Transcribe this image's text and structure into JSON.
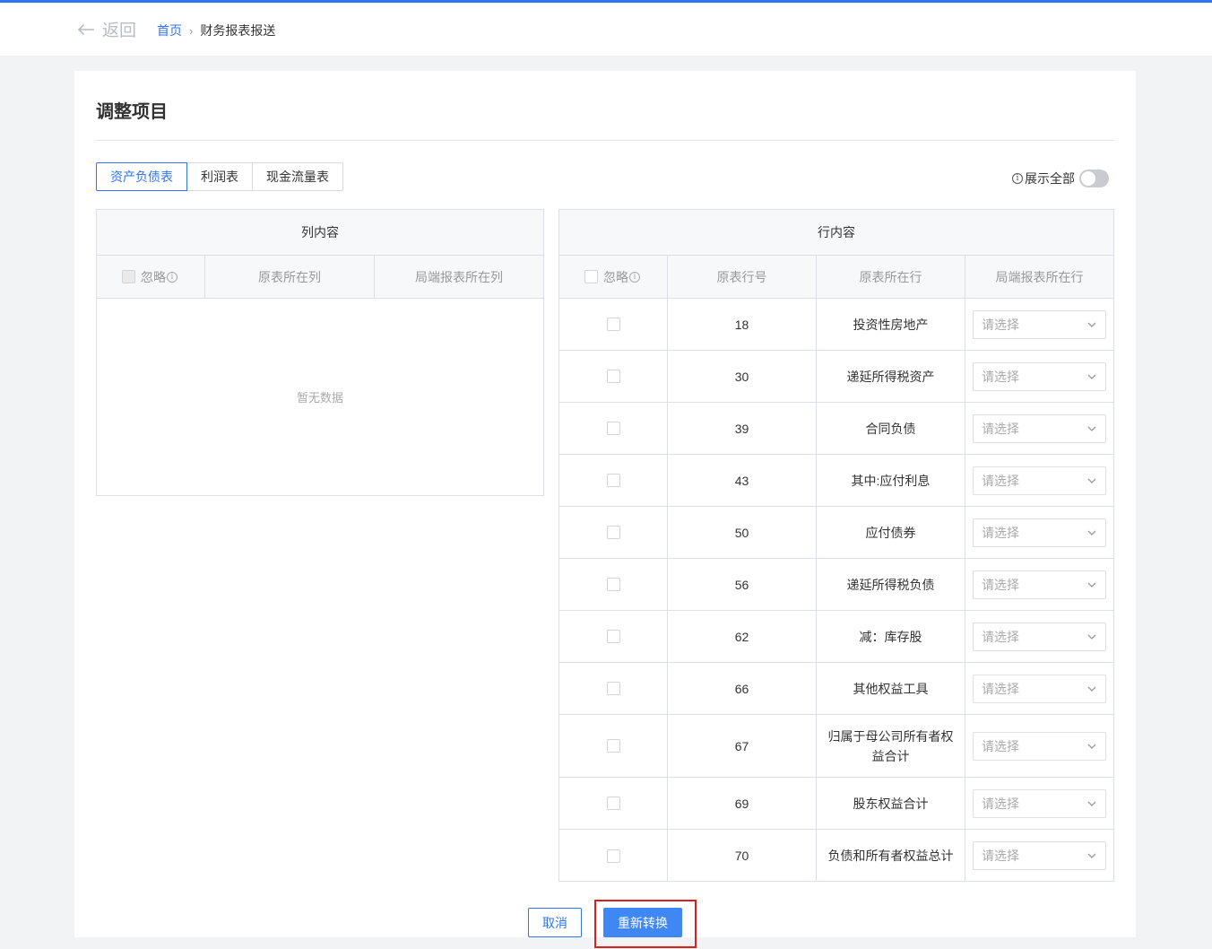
{
  "nav": {
    "back_label": "返回",
    "breadcrumb": {
      "home": "首页",
      "separator": "›",
      "current": "财务报表报送"
    }
  },
  "page": {
    "title": "调整项目"
  },
  "tabs": [
    {
      "label": "资产负债表",
      "active": true
    },
    {
      "label": "利润表",
      "active": false
    },
    {
      "label": "现金流量表",
      "active": false
    }
  ],
  "show_all": {
    "label": "展示全部",
    "enabled": false,
    "info_icon": "i"
  },
  "column_panel": {
    "title": "列内容",
    "headers": {
      "ignore": "忽略",
      "source": "原表所在列",
      "target": "局端报表所在列"
    },
    "empty_text": "暂无数据"
  },
  "row_panel": {
    "title": "行内容",
    "headers": {
      "ignore": "忽略",
      "row_no": "原表行号",
      "source": "原表所在行",
      "target": "局端报表所在行"
    },
    "select_placeholder": "请选择",
    "rows": [
      {
        "no": "18",
        "name": "投资性房地产"
      },
      {
        "no": "30",
        "name": "递延所得税资产"
      },
      {
        "no": "39",
        "name": "合同负债"
      },
      {
        "no": "43",
        "name": "其中:应付利息"
      },
      {
        "no": "50",
        "name": "应付债券"
      },
      {
        "no": "56",
        "name": "递延所得税负债"
      },
      {
        "no": "62",
        "name": "减：库存股"
      },
      {
        "no": "66",
        "name": "其他权益工具"
      },
      {
        "no": "67",
        "name": "归属于母公司所有者权益合计"
      },
      {
        "no": "69",
        "name": "股东权益合计"
      },
      {
        "no": "70",
        "name": "负债和所有者权益总计"
      }
    ]
  },
  "actions": {
    "cancel": "取消",
    "reconvert": "重新转换"
  },
  "colors": {
    "accent": "#2f74f0",
    "primary_button": "#3f87f5",
    "highlight": "#d9201f"
  }
}
